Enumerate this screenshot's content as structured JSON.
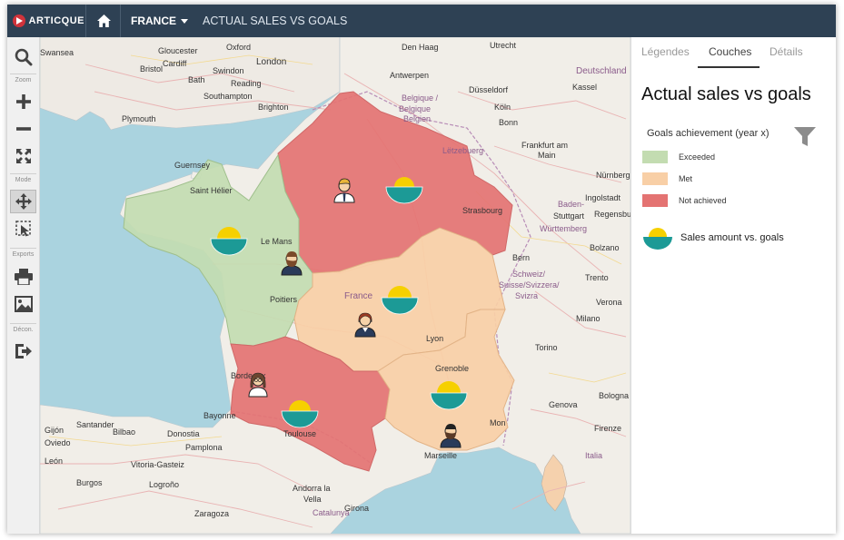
{
  "app": {
    "brand": "ARTICQUE"
  },
  "header": {
    "country": "FRANCE",
    "title": "ACTUAL SALES VS GOALS"
  },
  "toolbar": {
    "zoom_label": "Zoom",
    "mode_label": "Mode",
    "exports_label": "Exports",
    "logout_label": "Décon."
  },
  "panel": {
    "tabs": [
      {
        "label": "Légendes"
      },
      {
        "label": "Couches"
      },
      {
        "label": "Détails"
      }
    ],
    "active_tab": "Couches",
    "title": "Actual sales vs goals",
    "legend_title": "Goals achievement (year x)",
    "legend_items": [
      {
        "label": "Exceeded",
        "color": "#c3dcb1"
      },
      {
        "label": "Met",
        "color": "#f8cfa6"
      },
      {
        "label": "Not achieved",
        "color": "#e47372"
      }
    ],
    "sales_label": "Sales amount vs. goals"
  },
  "colors": {
    "topbar": "#2e4154",
    "exceeded": "#c3dcb1",
    "met": "#f8cfa6",
    "not_achieved": "#e47372",
    "sales_top": "#f6d000",
    "sales_bottom": "#1c9a96"
  },
  "map": {
    "regions": [
      {
        "name": "north",
        "status": "Not achieved"
      },
      {
        "name": "west",
        "status": "Exceeded"
      },
      {
        "name": "center",
        "status": "Met"
      },
      {
        "name": "southwest",
        "status": "Not achieved"
      },
      {
        "name": "southeast",
        "status": "Met"
      }
    ],
    "labels": {
      "swansea": "Swansea",
      "cardiff": "Cardiff",
      "gloucester": "Gloucester",
      "oxford": "Oxford",
      "london": "London",
      "bristol": "Bristol",
      "bath": "Bath",
      "swindon": "Swindon",
      "reading": "Reading",
      "southampton": "Southampton",
      "brighton": "Brighton",
      "plymouth": "Plymouth",
      "den_haag": "Den Haag",
      "utrecht": "Utrecht",
      "antwerpen": "Antwerpen",
      "belgique": "Belgique /",
      "belgique2": "Belgique",
      "belgien": "Belgien",
      "dusseldorf": "Düsseldorf",
      "koln": "Köln",
      "bonn": "Bonn",
      "deutschland": "Deutschland",
      "kassel": "Kassel",
      "frankfurt": "Frankfurt am",
      "main": "Main",
      "luxembourg": "Lëtzebuerg",
      "nurnberg": "Nürnberg",
      "strasbourg": "Strasbourg",
      "stuttgart": "Stuttgart",
      "baden": "Baden-",
      "wurttemberg": "Württemberg",
      "regensburg": "Regensburg",
      "ingolstadt": "Ingolstadt",
      "guernsey": "Guernsey",
      "saint_helier": "Saint Hélier",
      "le_mans": "Le Mans",
      "poitiers": "Poitiers",
      "france": "France",
      "schweiz": "Schweiz/",
      "suisse": "Suisse/Svizzera/",
      "svizra": "Svizra",
      "bern": "Bern",
      "lyon": "Lyon",
      "grenoble": "Grenoble",
      "bordeaux": "Bordeaux",
      "toulouse": "Toulouse",
      "marseille": "Marseille",
      "monaco": "Mon",
      "genova": "Genova",
      "firenze": "Firenze",
      "bologna": "Bologna",
      "torino": "Torino",
      "milano": "Milano",
      "verona": "Verona",
      "bolzano": "Bolzano",
      "trento": "Trento",
      "italia": "Italia",
      "vitoria": "Vitoria-Gasteiz",
      "pamplona": "Pamplona",
      "logrono": "Logroño",
      "burgos": "Burgos",
      "zaragoza": "Zaragoza",
      "andorra": "Andorra la",
      "vella": "Vella",
      "catalunya": "Catalunya",
      "girona": "Girona",
      "gijon": "Gijón",
      "bilbao": "Bilbao",
      "oviedo": "Oviedo",
      "santander": "Santander",
      "donostia": "Donostia",
      "leon": "León",
      "bayonne": "Bayonne"
    }
  }
}
